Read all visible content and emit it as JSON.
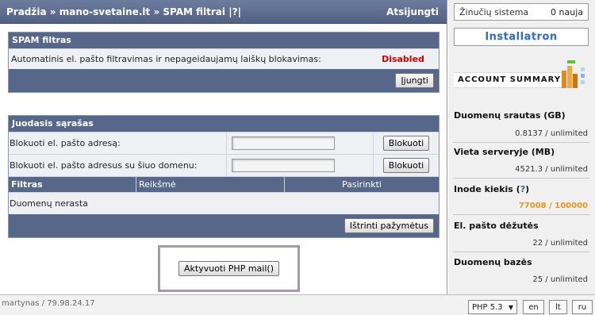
{
  "header": {
    "home": "Pradžia",
    "sep1": "»",
    "site": "mano-svetaine.lt",
    "sep2": "»",
    "page": "SPAM filtrai",
    "help": "|?|",
    "logout": "Atsijungti"
  },
  "spam": {
    "title": "SPAM filtras",
    "description": "Automatinis el. pašto filtravimas ir nepageidaujamų laiškų blokavimas:",
    "status": "Disabled",
    "status_color": "#cc0000",
    "enable_button": "Įjungti"
  },
  "blacklist": {
    "title": "Juodasis sąrašas",
    "block_email_label": "Blokuoti el. pašto adresą:",
    "block_domain_label": "Blokuoti el. pašto adresus su šiuo domenu:",
    "block_button": "Blokuoti",
    "columns": [
      "Filtras",
      "Reikšmė",
      "Pasirinkti"
    ],
    "empty": "Duomenų nerasta",
    "delete_button": "Ištrinti pažymėtus"
  },
  "php_mail_button": "Aktyvuoti PHP mail()",
  "sidebar": {
    "notifications_label": "Žinučių sistema",
    "notifications_count": "0 nauja",
    "installatron": "Installatron",
    "account_summary": "ACCOUNT SUMMARY",
    "stats": [
      {
        "title": "Duomenų srautas (GB)",
        "value": "0.8137 / unlimited"
      },
      {
        "title": "Vieta serveryje (MB)",
        "value": "4521.3 / unlimited"
      },
      {
        "title": "Inode kiekis",
        "help": "?",
        "value": "77008 / 100000",
        "value_color": "#e8961e"
      },
      {
        "title": "El. pašto dėžutės",
        "value": "22 / unlimited"
      },
      {
        "title": "Duomenų bazės",
        "value": "25 / unlimited"
      }
    ]
  },
  "footer": {
    "user": "martynas / 79.98.24.17",
    "php_version": "PHP 5.3",
    "languages": [
      "en",
      "lt",
      "ru"
    ]
  }
}
